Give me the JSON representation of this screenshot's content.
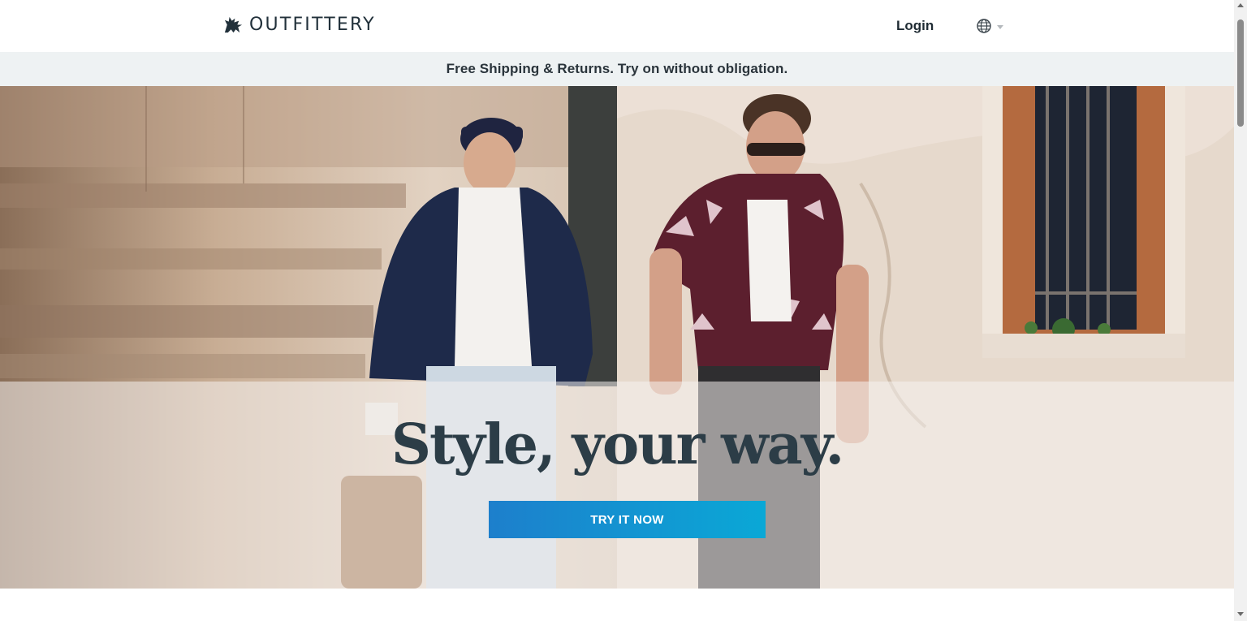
{
  "header": {
    "brand": "OUTFITTERY",
    "logo_icon": "griffin-icon",
    "login_label": "Login",
    "language_icon": "globe-icon"
  },
  "banner": {
    "text": "Free Shipping & Returns. Try on without obligation."
  },
  "hero": {
    "headline": "Style, your way.",
    "cta_label": "TRY IT NOW",
    "left_image": "man-in-navy-blazer-and-cap",
    "right_image": "man-in-floral-shirt-and-sunglasses"
  },
  "colors": {
    "brand_text": "#22313b",
    "banner_bg": "#eef2f3",
    "cta_start": "#1d7fcc",
    "cta_end": "#0aa8d6",
    "headline": "#2c3d47"
  }
}
